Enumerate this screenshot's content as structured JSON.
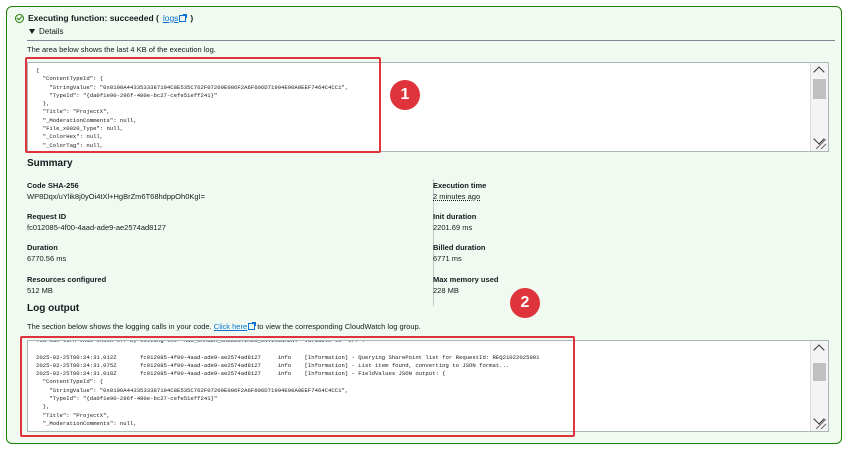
{
  "status": {
    "text": "Executing function: succeeded (",
    "link": "logs",
    "close": ")"
  },
  "details": {
    "toggle_label": "Details",
    "description": "The area below shows the last 4 KB of the execution log.",
    "log_lines": [
      "{",
      "  \"ContentTypeId\": {",
      "    \"StringValue\": \"0x0100A4433533387194C8E535C762F07209E006F2A6F606D71994E90A0EEF7464C4CC1\",",
      "    \"TypeId\": \"{da0f1e90-296f-480e-bc27-cefe51eff241}\"",
      "  },",
      "  \"Title\": \"ProjectX\",",
      "  \"_ModerationComments\": null,",
      "  \"File_x0020_Type\": null,",
      "  \"_ColorHex\": null,",
      "  \"_ColorTag\": null,"
    ]
  },
  "summary": {
    "title": "Summary",
    "left": [
      {
        "label": "Code SHA-256",
        "value": "WP8Dqx/uYlik8j0yOi4tXl+HgBrZm6T68hdppOh0KgI="
      },
      {
        "label": "Request ID",
        "value": "fc012085-4f00-4aad-ade9-ae2574ad8127"
      },
      {
        "label": "Duration",
        "value": "6770.56 ms"
      },
      {
        "label": "Resources configured",
        "value": "512 MB"
      }
    ],
    "right": [
      {
        "label": "Execution time",
        "value": "2 minutes ago"
      },
      {
        "label": "Init duration",
        "value": "2201.69 ms"
      },
      {
        "label": "Billed duration",
        "value": "6771 ms"
      },
      {
        "label": "Max memory used",
        "value": "228 MB"
      }
    ]
  },
  "log_output": {
    "title": "Log output",
    "description_pre": "The section below shows the logging calls in your code. ",
    "link": "Click here",
    "description_post": " to view the corresponding CloudWatch log group.",
    "lines": [
      "You can turn this check off by setting the 'AWS_LAMBDA_CREDENTIALS_ENVIRONMENT' variable to 'off'.",
      "",
      "2025-02-25T00:24:31.012Z       fc012085-4f00-4aad-ade9-ae2574ad8127     info    [Information] - Querying SharePoint list for RequestId: REQ21022025001",
      "2025-02-25T00:24:31.075Z       fc012085-4f00-4aad-ade9-ae2574ad8127     info    [Information] - List item found, converting to JSON format...",
      "2025-02-25T00:24:31.018Z       fc012085-4f00-4aad-ade9-ae2574ad8127     info    [Information] - FieldValues JSON output: {",
      "  \"ContentTypeId\": {",
      "    \"StringValue\": \"0x0100A4433533387194C8E535C762F07209E006F2A6F606D71994E90A0EEF7464C4CC1\",",
      "    \"TypeId\": \"{da0f1e90-296f-480e-bc27-cefe51eff241}\"",
      "  },",
      "  \"Title\": \"ProjectX\",",
      "  \"_ModerationComments\": null,"
    ]
  },
  "callouts": {
    "one": "1",
    "two": "2"
  },
  "colors": {
    "success": "#1d8102",
    "link": "#0972d3",
    "callout": "#e0343c",
    "panel_bg": "#f1faf0"
  }
}
